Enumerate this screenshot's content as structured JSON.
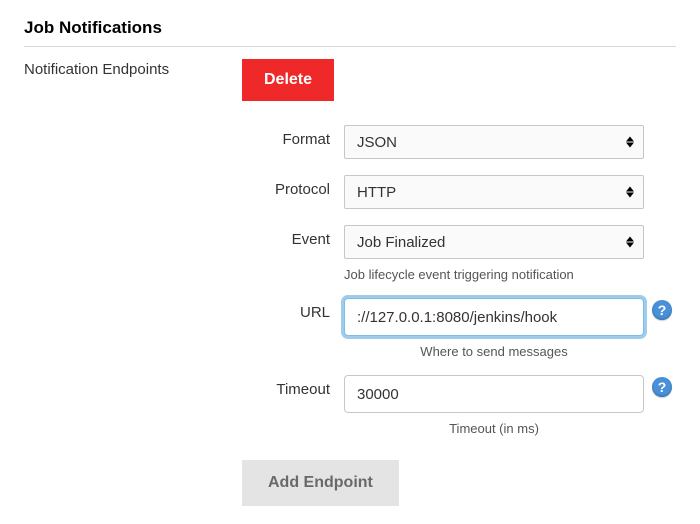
{
  "section": {
    "title": "Job Notifications",
    "endpoints_label": "Notification Endpoints",
    "delete_label": "Delete",
    "add_label": "Add Endpoint"
  },
  "fields": {
    "format": {
      "label": "Format",
      "value": "JSON"
    },
    "protocol": {
      "label": "Protocol",
      "value": "HTTP"
    },
    "event": {
      "label": "Event",
      "value": "Job Finalized",
      "hint": "Job lifecycle event triggering notification"
    },
    "url": {
      "label": "URL",
      "value": "://127.0.0.1:8080/jenkins/hook",
      "hint": "Where to send messages"
    },
    "timeout": {
      "label": "Timeout",
      "value": "30000",
      "hint": "Timeout (in ms)"
    }
  },
  "help_glyph": "?"
}
